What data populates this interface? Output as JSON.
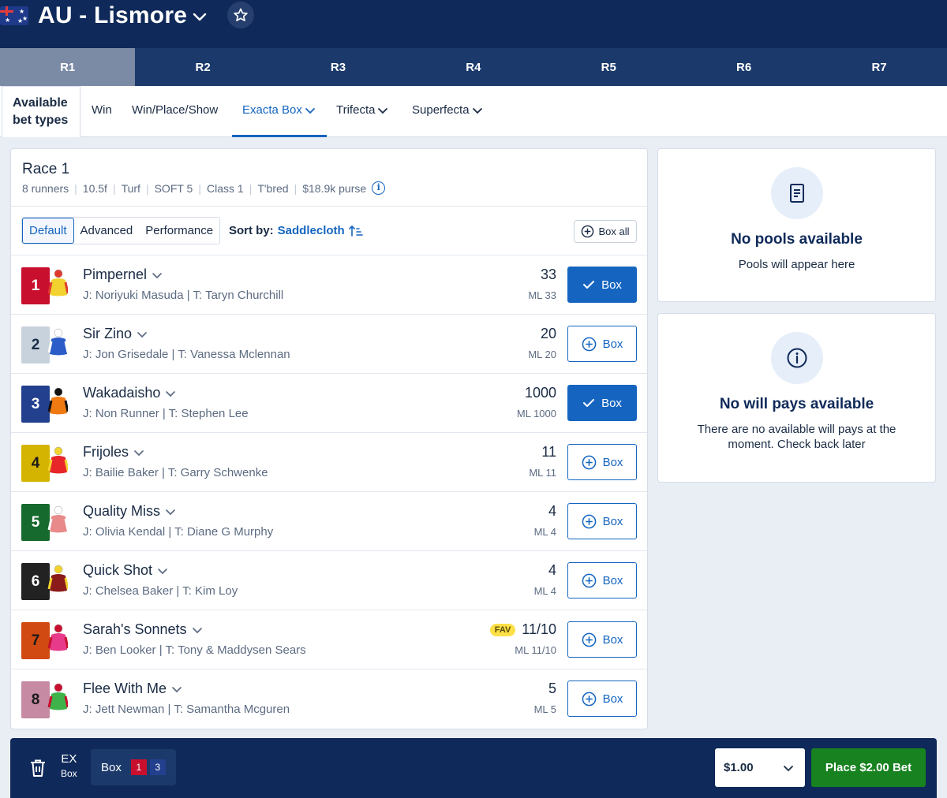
{
  "header": {
    "venue": "AU - Lismore"
  },
  "race_tabs": [
    "R1",
    "R2",
    "R3",
    "R4",
    "R5",
    "R6",
    "R7"
  ],
  "bet_types": {
    "available_label_line1": "Available",
    "available_label_line2": "bet types",
    "items": [
      "Win",
      "Win/Place/Show",
      "Exacta Box",
      "Trifecta",
      "Superfecta"
    ],
    "active": "Exacta Box"
  },
  "race": {
    "title": "Race 1",
    "meta": [
      "8 runners",
      "10.5f",
      "Turf",
      "SOFT 5",
      "Class 1",
      "T'bred",
      "$18.9k purse"
    ]
  },
  "views": [
    "Default",
    "Advanced",
    "Performance"
  ],
  "sort": {
    "label": "Sort by:",
    "value": "Saddlecloth"
  },
  "box_all_label": "Box all",
  "runners": [
    {
      "number": "1",
      "name": "Pimpernel",
      "jt": "J: Noriyuki Masuda | T: Taryn Churchill",
      "odds": "33",
      "ml": "ML 33",
      "box": "Box",
      "selected": true,
      "cloth_bg": "#c8102e",
      "cloth_fg": "#ffffff"
    },
    {
      "number": "2",
      "name": "Sir Zino",
      "jt": "J: Jon Grisedale | T: Vanessa Mclennan",
      "odds": "20",
      "ml": "ML 20",
      "box": "Box",
      "selected": false,
      "cloth_bg": "#c7d2dc",
      "cloth_fg": "#1a2b45"
    },
    {
      "number": "3",
      "name": "Wakadaisho",
      "jt": "J: Non Runner | T: Stephen Lee",
      "odds": "1000",
      "ml": "ML 1000",
      "box": "Box",
      "selected": true,
      "cloth_bg": "#23408e",
      "cloth_fg": "#ffffff"
    },
    {
      "number": "4",
      "name": "Frijoles",
      "jt": "J: Bailie Baker | T: Garry Schwenke",
      "odds": "11",
      "ml": "ML 11",
      "box": "Box",
      "selected": false,
      "cloth_bg": "#d4b400",
      "cloth_fg": "#1a1a1a"
    },
    {
      "number": "5",
      "name": "Quality Miss",
      "jt": "J: Olivia Kendal | T: Diane G Murphy",
      "odds": "4",
      "ml": "ML 4",
      "box": "Box",
      "selected": false,
      "cloth_bg": "#176a2d",
      "cloth_fg": "#ffffff"
    },
    {
      "number": "6",
      "name": "Quick Shot",
      "jt": "J: Chelsea Baker | T: Kim Loy",
      "odds": "4",
      "ml": "ML 4",
      "box": "Box",
      "selected": false,
      "cloth_bg": "#222222",
      "cloth_fg": "#ffffff"
    },
    {
      "number": "7",
      "name": "Sarah's Sonnets",
      "jt": "J: Ben Looker | T: Tony & Maddysen Sears",
      "odds": "11/10",
      "ml": "ML 11/10",
      "box": "Box",
      "selected": false,
      "fav": "FAV",
      "cloth_bg": "#d04a12",
      "cloth_fg": "#1a1a1a"
    },
    {
      "number": "8",
      "name": "Flee With Me",
      "jt": "J: Jett Newman | T: Samantha Mcguren",
      "odds": "5",
      "ml": "ML 5",
      "box": "Box",
      "selected": false,
      "cloth_bg": "#c78aa3",
      "cloth_fg": "#1a1a1a"
    }
  ],
  "pools_panel": {
    "title": "No pools available",
    "text": "Pools will appear here"
  },
  "willpays_panel": {
    "title": "No will pays available",
    "text": "There are no available will pays at the moment. Check back later"
  },
  "bet_slip": {
    "type_line1": "EX",
    "type_line2": "Box",
    "chip_label": "Box",
    "chip_numbers": [
      "1",
      "3"
    ],
    "stake": "$1.00",
    "place_label": "Place $2.00 Bet"
  },
  "colors": {
    "brand_navy": "#0f2a5a",
    "accent_blue": "#1565c0",
    "place_green": "#17821f",
    "fav_yellow": "#fde047"
  }
}
